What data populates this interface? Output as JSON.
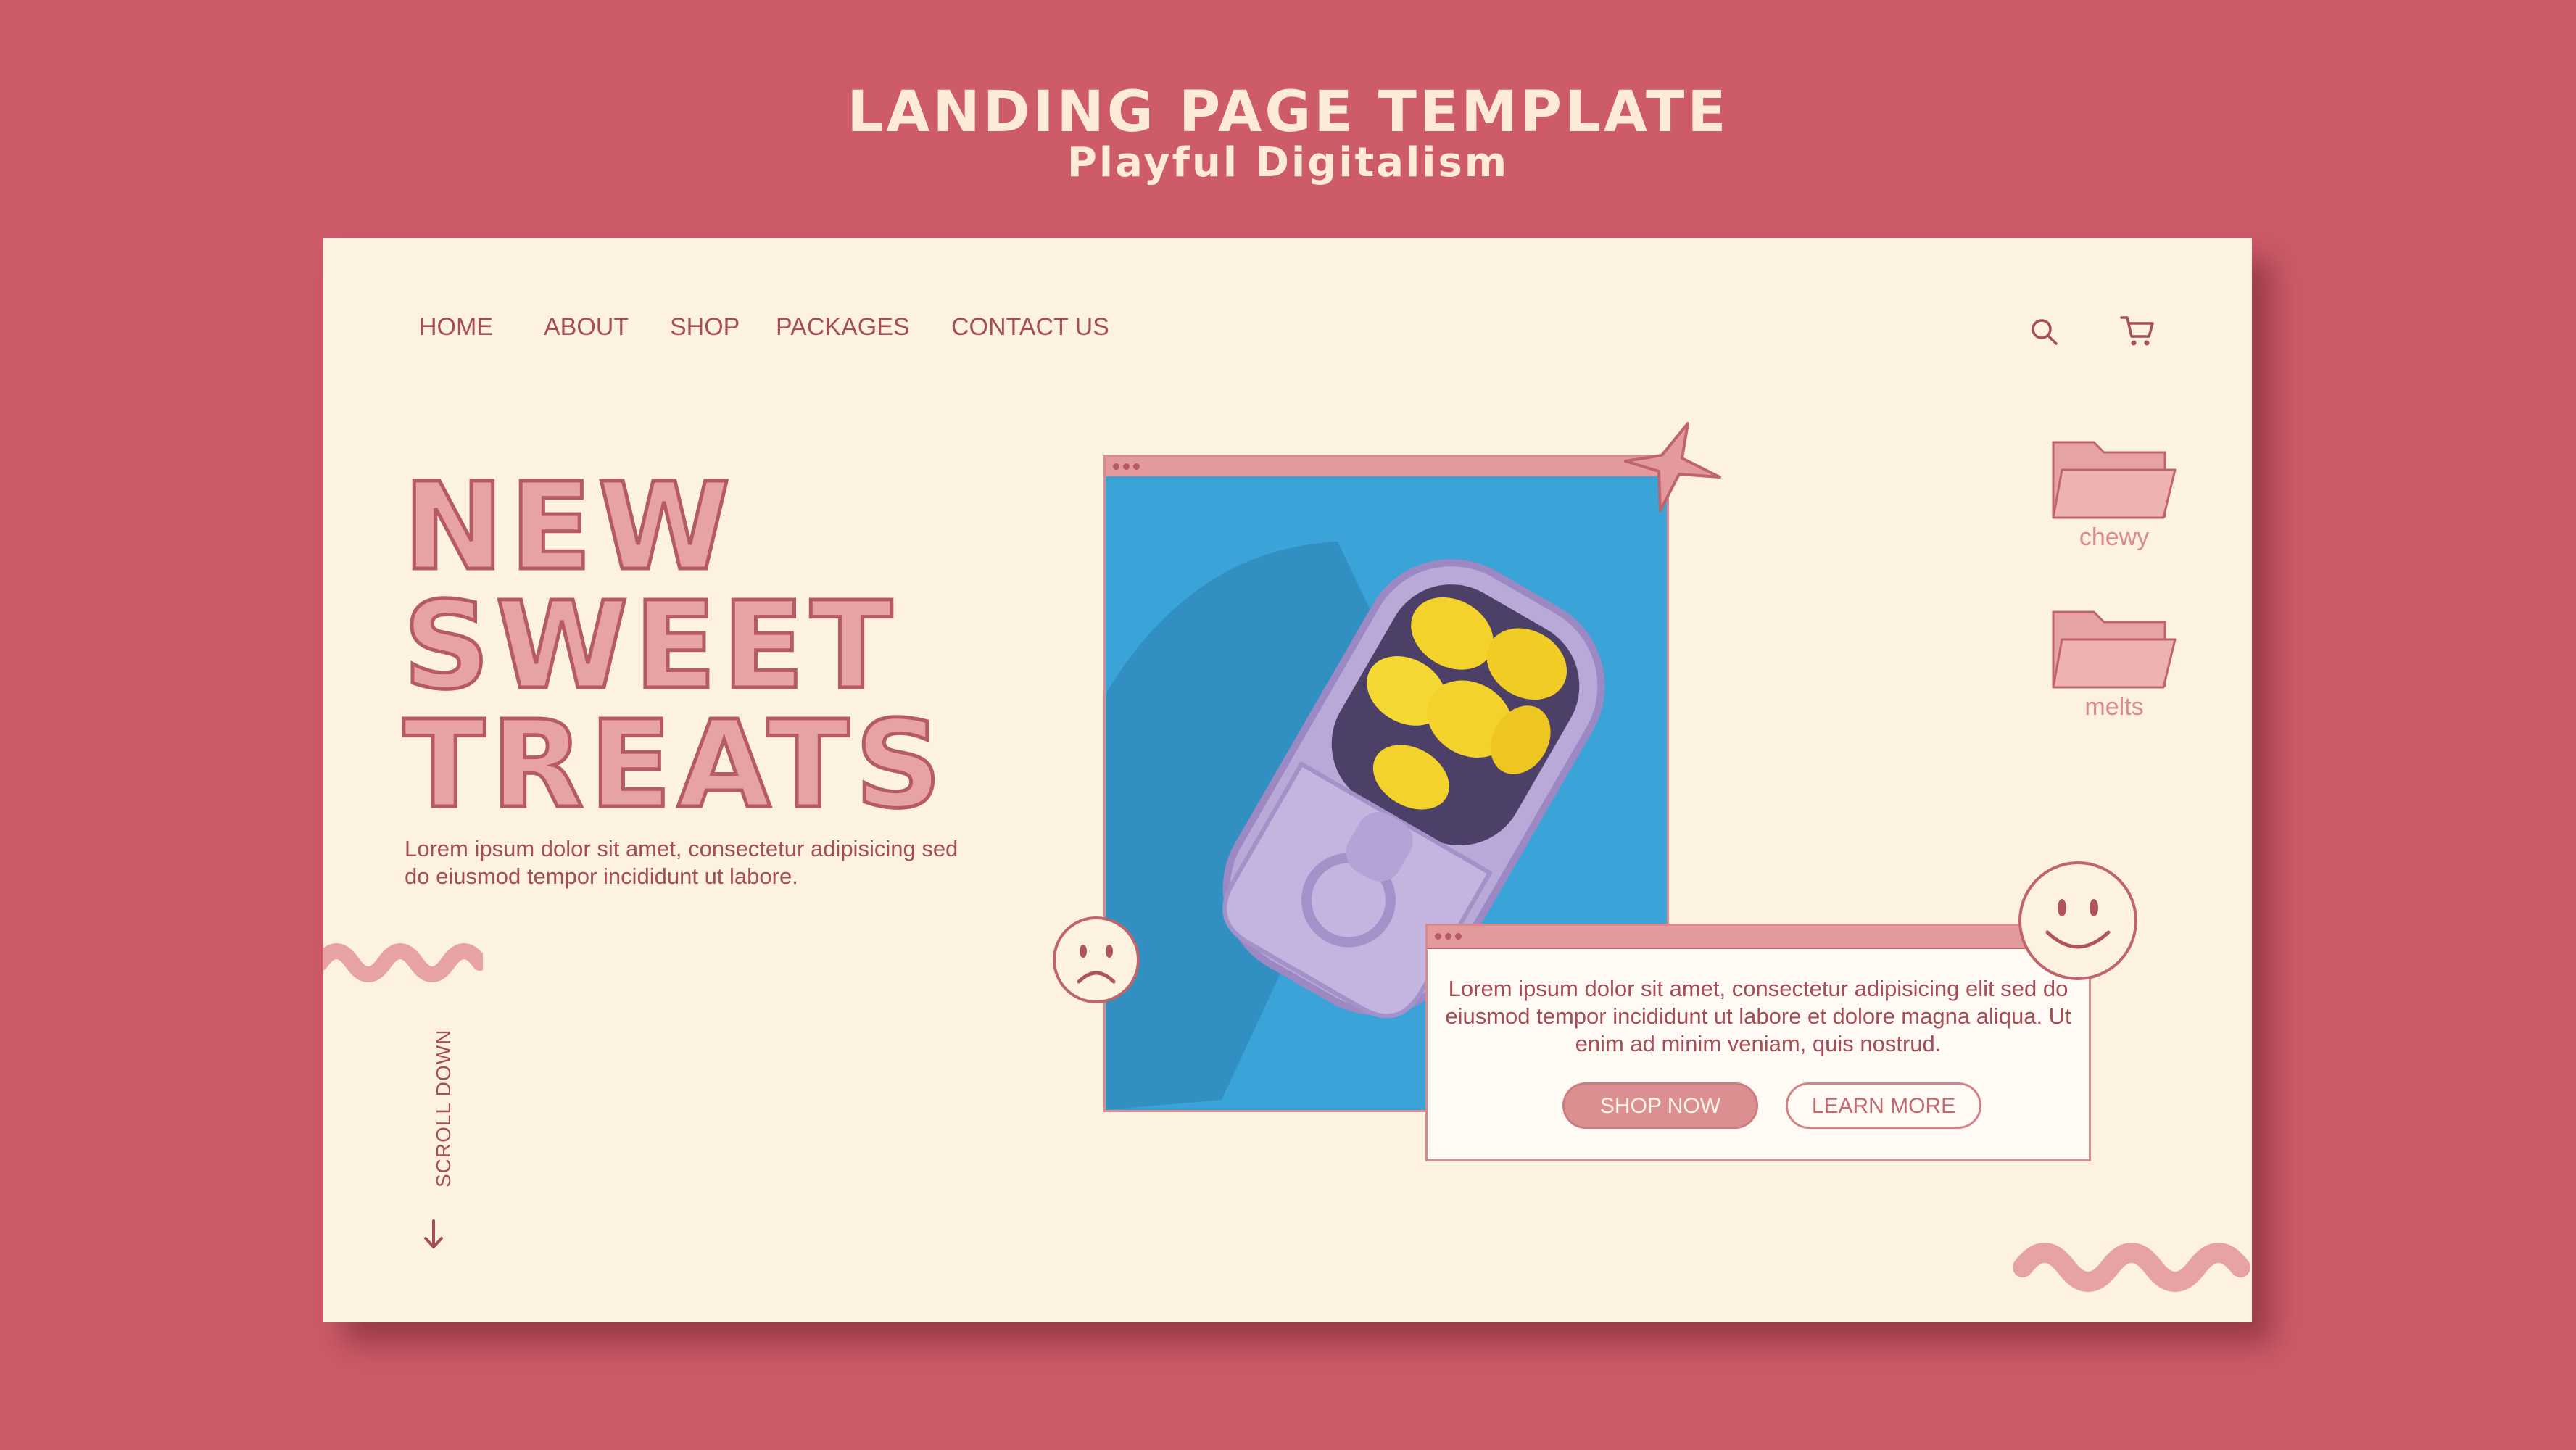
{
  "header": {
    "title": "LANDING PAGE TEMPLATE",
    "subtitle": "Playful Digitalism"
  },
  "nav": {
    "items": [
      "HOME",
      "ABOUT",
      "SHOP",
      "PACKAGES",
      "CONTACT US"
    ],
    "search_icon": "search-icon",
    "cart_icon": "cart-icon"
  },
  "hero": {
    "title_lines": [
      "NEW",
      "SWEET",
      "TREATS"
    ],
    "description": "Lorem ipsum dolor sit amet, consectetur adipisicing sed do eiusmod tempor incididunt ut labore."
  },
  "scroll": {
    "label": "SCROLL DOWN",
    "icon": "arrow-down-icon"
  },
  "folders": [
    {
      "label": "chewy",
      "icon": "folder-icon"
    },
    {
      "label": "melts",
      "icon": "folder-icon"
    }
  ],
  "info_card": {
    "text": "Lorem ipsum dolor sit amet, consectetur adipisicing elit sed do eiusmod tempor incididunt ut labore et dolore magna aliqua. Ut enim ad minim veniam, quis nostrud.",
    "shop_now": "SHOP NOW",
    "learn_more": "LEARN MORE"
  },
  "colors": {
    "background": "#cd5b69",
    "card": "#fdf1e2",
    "accent_pink": "#e7a3a3",
    "text_rose": "#a54e56",
    "photo_blue": "#3aa3d7",
    "candy_yellow": "#f3d22b",
    "tin_lavender": "#b9a9d8"
  }
}
